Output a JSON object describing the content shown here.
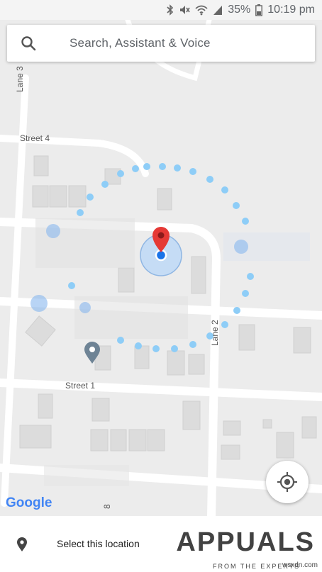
{
  "status_bar": {
    "battery": "35%",
    "time": "10:19 pm"
  },
  "search": {
    "placeholder": "Search, Assistant & Voice"
  },
  "map": {
    "road_labels": {
      "lane3": "Lane 3",
      "street4": "Street 4",
      "lane2": "Lane 2",
      "street1": "Street 1",
      "lane8": "8"
    },
    "marker_color": "#e53935",
    "accent_blue": "#1a73e8",
    "radius_dot_color": "#8ecdf7"
  },
  "logo": {
    "text": "Google"
  },
  "bottom_panel": {
    "select_label": "Select this location"
  },
  "watermark": {
    "brand": "APPUALS",
    "tagline": "FROM THE EXPERTS",
    "site": "wsxdn.com"
  }
}
